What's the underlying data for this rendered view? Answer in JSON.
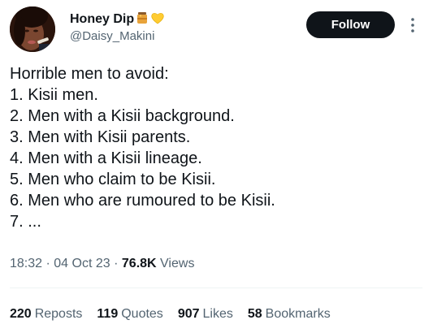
{
  "author": {
    "display_name": "Honey Dip",
    "handle": "@Daisy_Makini",
    "emoji_icons": [
      "honey-pot-icon",
      "yellow-heart-icon"
    ]
  },
  "follow_button": {
    "label": "Follow"
  },
  "more_icon": "vertical-ellipsis-icon",
  "tweet": {
    "lines": [
      "Horrible men to avoid:",
      "1. Kisii men.",
      "2. Men with a Kisii background.",
      "3. Men with Kisii parents.",
      "4. Men with a Kisii lineage.",
      "5. Men who claim to be Kisii.",
      "6. Men who are rumoured to be Kisii.",
      "7. ..."
    ]
  },
  "meta": {
    "time": "18:32",
    "separator": "·",
    "date": "04 Oct 23",
    "views_count": "76.8K",
    "views_label": "Views"
  },
  "stats": {
    "reposts": {
      "count": "220",
      "label": "Reposts"
    },
    "quotes": {
      "count": "119",
      "label": "Quotes"
    },
    "likes": {
      "count": "907",
      "label": "Likes"
    },
    "bookmarks": {
      "count": "58",
      "label": "Bookmarks"
    }
  },
  "colors": {
    "text": "#0f1419",
    "secondary": "#536471",
    "follow_bg": "#0f1419",
    "divider": "#eff3f4"
  }
}
